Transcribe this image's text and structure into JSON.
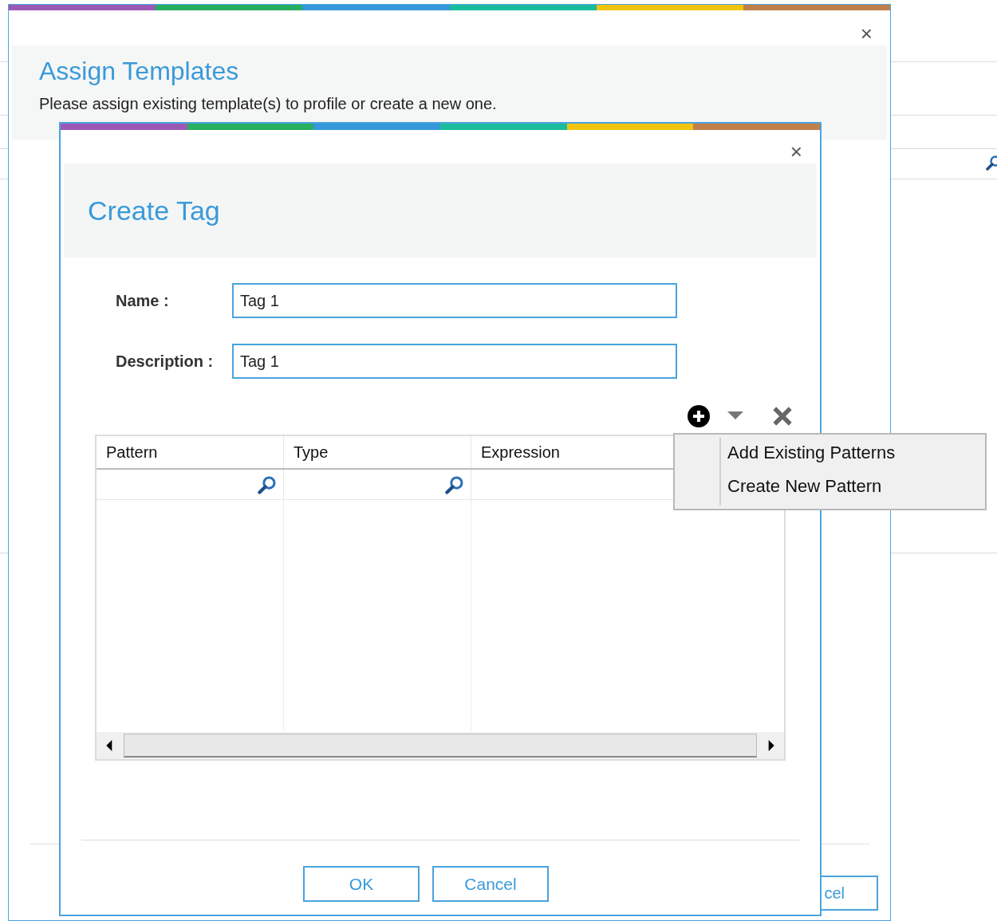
{
  "outer_dialog": {
    "title": "Assign Templates",
    "subtitle": "Please assign existing template(s) to profile or create a new one.",
    "close_label": "×",
    "partial_button": "cel"
  },
  "dialog": {
    "title": "Create Tag",
    "close_label": "×",
    "fields": [
      {
        "label": "Name :",
        "value": "Tag 1"
      },
      {
        "label": "Description :",
        "value": "Tag 1"
      }
    ],
    "table": {
      "columns": [
        {
          "label": "Pattern",
          "filter": true
        },
        {
          "label": "Type",
          "filter": true
        },
        {
          "label": "Expression"
        }
      ]
    },
    "buttons": [
      "OK",
      "Cancel"
    ]
  },
  "menu": {
    "items": [
      "Add Existing Patterns",
      "Create New Pattern"
    ]
  }
}
